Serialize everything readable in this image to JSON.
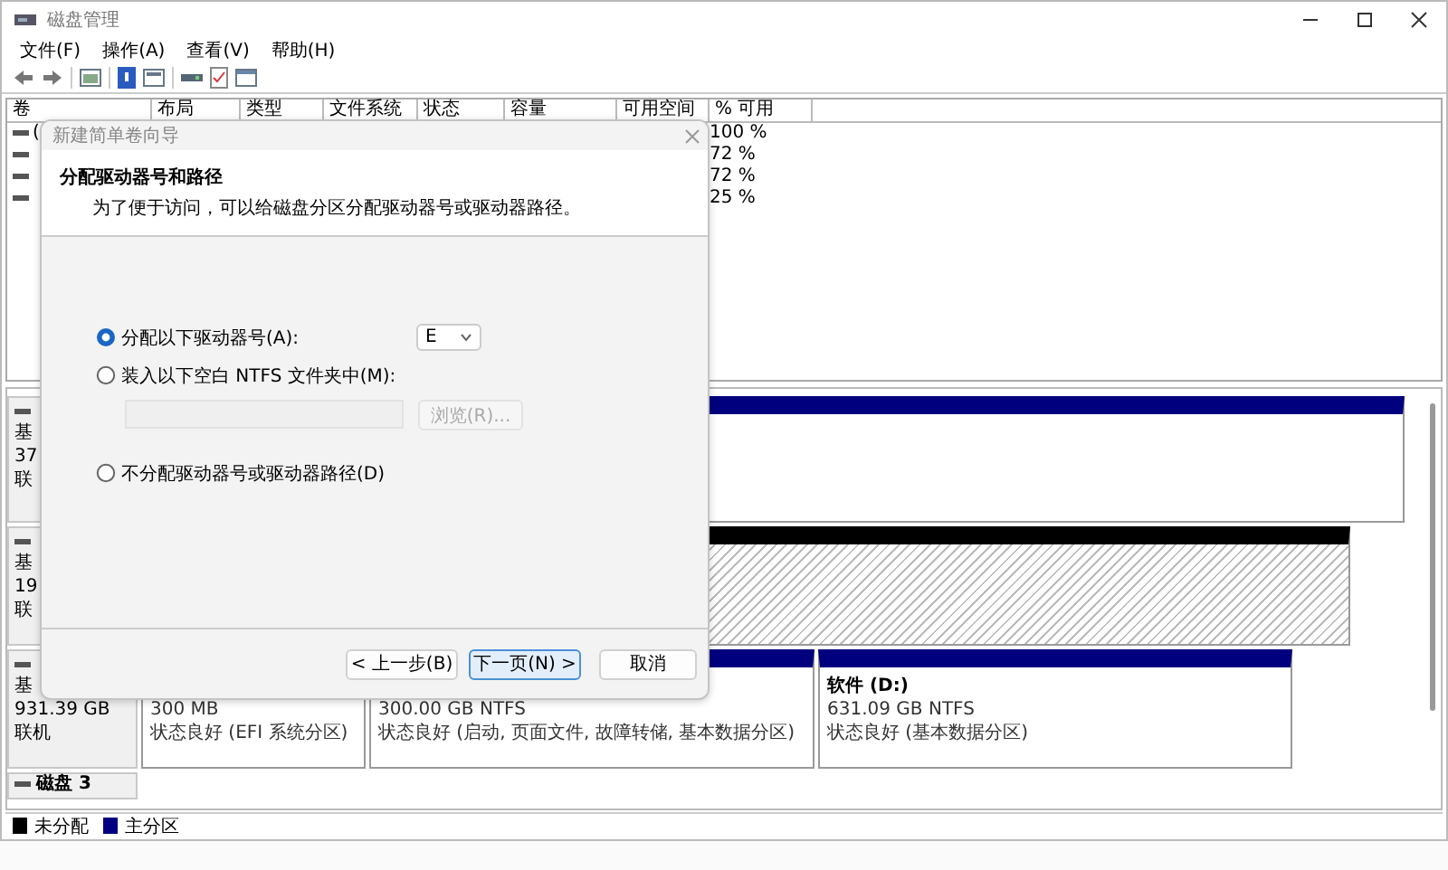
{
  "window": {
    "title": "磁盘管理"
  },
  "menu": [
    "文件(F)",
    "操作(A)",
    "查看(V)",
    "帮助(H)"
  ],
  "volume_table": {
    "columns": [
      "卷",
      "布局",
      "类型",
      "文件系统",
      "状态",
      "容量",
      "可用空间",
      "% 可用"
    ],
    "rows": [
      {
        "volume": "(",
        "percent_free": "100 %"
      },
      {
        "percent_free": "72 %"
      },
      {
        "percent_free": "72 %"
      },
      {
        "percent_free": "25 %"
      }
    ]
  },
  "disks": [
    {
      "type": "基",
      "size": "37",
      "status": "联",
      "partitions": [
        {
          "kind": "primary"
        }
      ]
    },
    {
      "type": "基",
      "size": "19",
      "status": "联",
      "partitions": [
        {
          "kind": "unallocated"
        }
      ]
    },
    {
      "type": "基",
      "size": "931.39 GB",
      "status": "联机",
      "partitions": [
        {
          "kind": "primary",
          "size": "300 MB",
          "status": "状态良好 (EFI 系统分区)"
        },
        {
          "kind": "primary",
          "size": "300.00 GB NTFS",
          "status": "状态良好 (启动, 页面文件, 故障转储, 基本数据分区)"
        },
        {
          "kind": "primary",
          "title": "软件 (D:)",
          "size": "631.09 GB NTFS",
          "status": "状态良好 (基本数据分区)"
        }
      ]
    },
    {
      "name": "磁盘 3"
    }
  ],
  "legend": [
    {
      "label": "未分配",
      "color": "#000000"
    },
    {
      "label": "主分区",
      "color": "#000080"
    }
  ],
  "wizard": {
    "title": "新建简单卷向导",
    "heading": "分配驱动器号和路径",
    "subtitle": "为了便于访问，可以给磁盘分区分配驱动器号或驱动器路径。",
    "options": [
      {
        "label": "分配以下驱动器号(A):",
        "selected": true
      },
      {
        "label": "装入以下空白 NTFS 文件夹中(M):",
        "selected": false
      },
      {
        "label": "不分配驱动器号或驱动器路径(D)",
        "selected": false
      }
    ],
    "drive_letter": "E",
    "folder_field": {
      "disabled": true
    },
    "browse_button": {
      "label": "浏览(R)...",
      "disabled": true
    },
    "buttons": [
      {
        "label": "< 上一步(B)",
        "default": false
      },
      {
        "label": "下一页(N) >",
        "default": true
      },
      {
        "label": "取消",
        "default": false
      }
    ]
  }
}
